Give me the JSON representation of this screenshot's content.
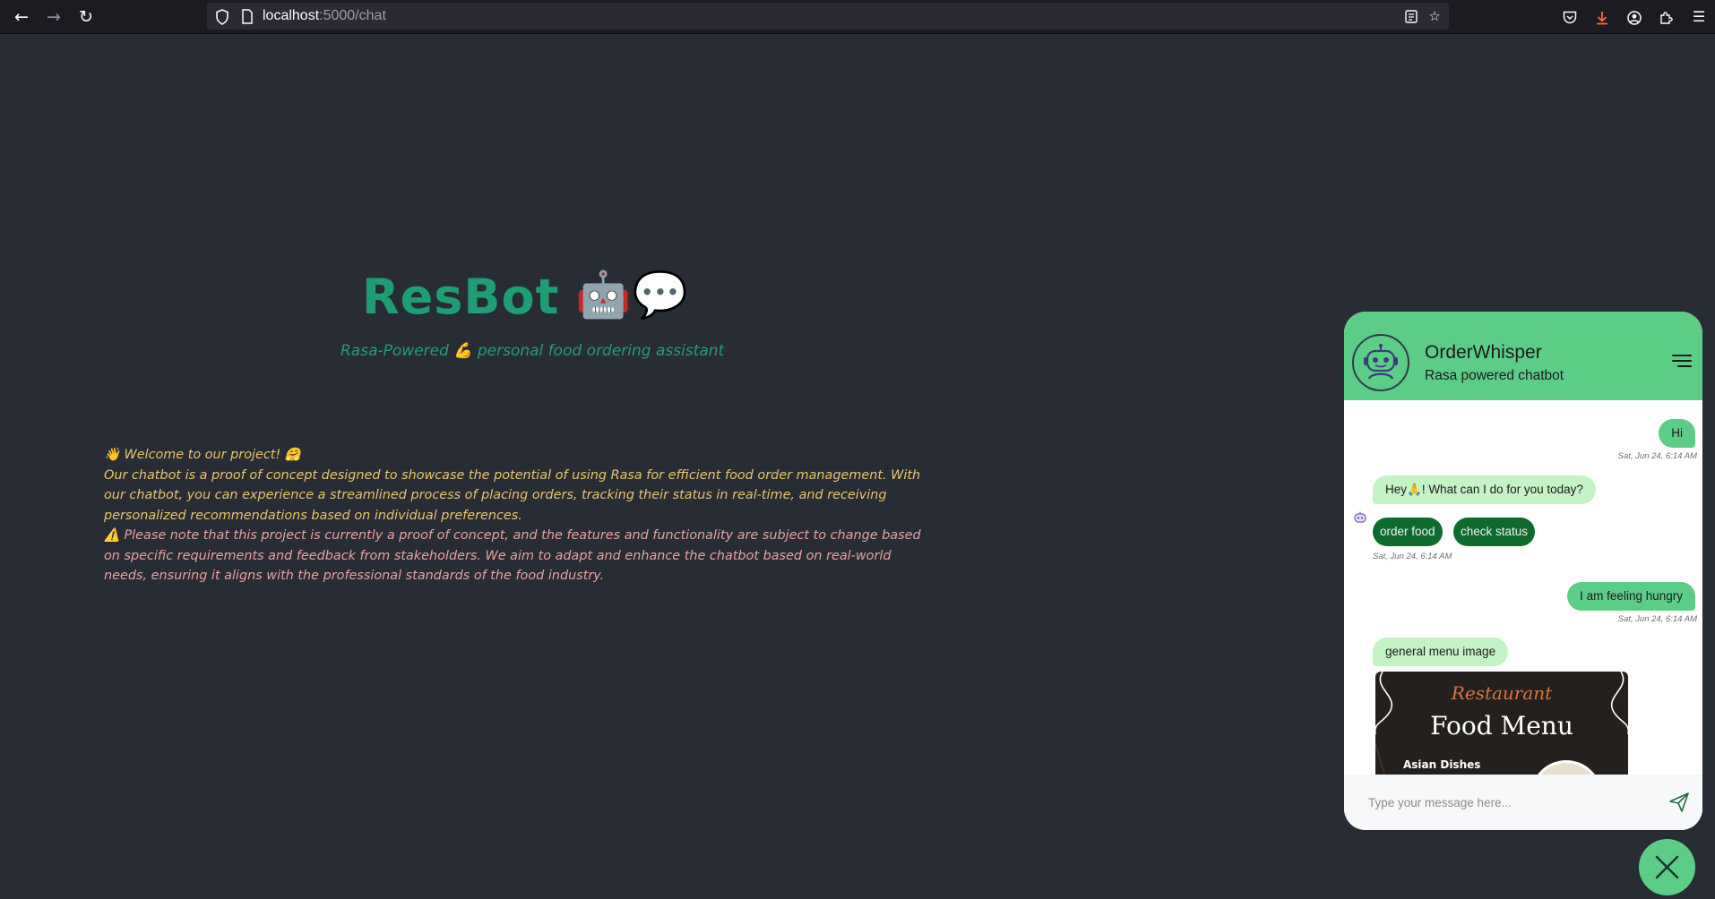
{
  "browser": {
    "url_host": "localhost",
    "url_path": ":5000/chat",
    "icons": [
      "back-icon",
      "forward-icon",
      "reload-icon",
      "shield-icon",
      "page-icon",
      "reader-view-icon",
      "bookmark-star-icon",
      "pocket-icon",
      "download-icon",
      "account-icon",
      "extensions-icon",
      "app-menu-icon"
    ],
    "download_accent": "#ff6a3c"
  },
  "hero": {
    "title": "ResBot",
    "title_emoji": "🤖💬",
    "subtitle": "Rasa-Powered 💪 personal food ordering assistant",
    "title_color": "#1f9e75"
  },
  "intro": {
    "welcome": "👋 Welcome to our project! 🤗",
    "description": "Our chatbot is a proof of concept designed to showcase the potential of using Rasa for efficient food order management. With our chatbot, you can experience a streamlined process of placing orders, tracking their status in real-time, and receiving personalized recommendations based on individual preferences.",
    "notice": "⚠️ Please note that this project is currently a proof of concept, and the features and functionality are subject to change based on specific requirements and feedback from stakeholders. We aim to adapt and enhance the chatbot based on real-world needs, ensuring it aligns with the professional standards of the food industry.",
    "description_color": "#e9c46a",
    "notice_color": "#e8a1a1"
  },
  "chat": {
    "bot_name": "OrderWhisper",
    "bot_tagline": "Rasa powered chatbot",
    "accent": "#5ccd86",
    "messages": [
      {
        "from": "user",
        "text": "Hi",
        "time": "Sat, Jun 24, 6:14 AM"
      },
      {
        "from": "bot",
        "text": "Hey🙏! What can I do for you today?",
        "time": "Sat, Jun 24, 6:14 AM"
      },
      {
        "from": "user",
        "text": "I am feeling hungry",
        "time": "Sat, Jun 24, 6:14 AM"
      },
      {
        "from": "bot",
        "text": "general menu image"
      }
    ],
    "quick_replies": [
      "order food",
      "check status"
    ],
    "menu_image": {
      "script": "Restaurant",
      "title": "Food Menu",
      "section": "Asian Dishes"
    },
    "input_placeholder": "Type your message here...",
    "icons": [
      "bot-avatar-icon",
      "menu-icon",
      "small-bot-icon",
      "send-icon",
      "close-icon"
    ]
  }
}
